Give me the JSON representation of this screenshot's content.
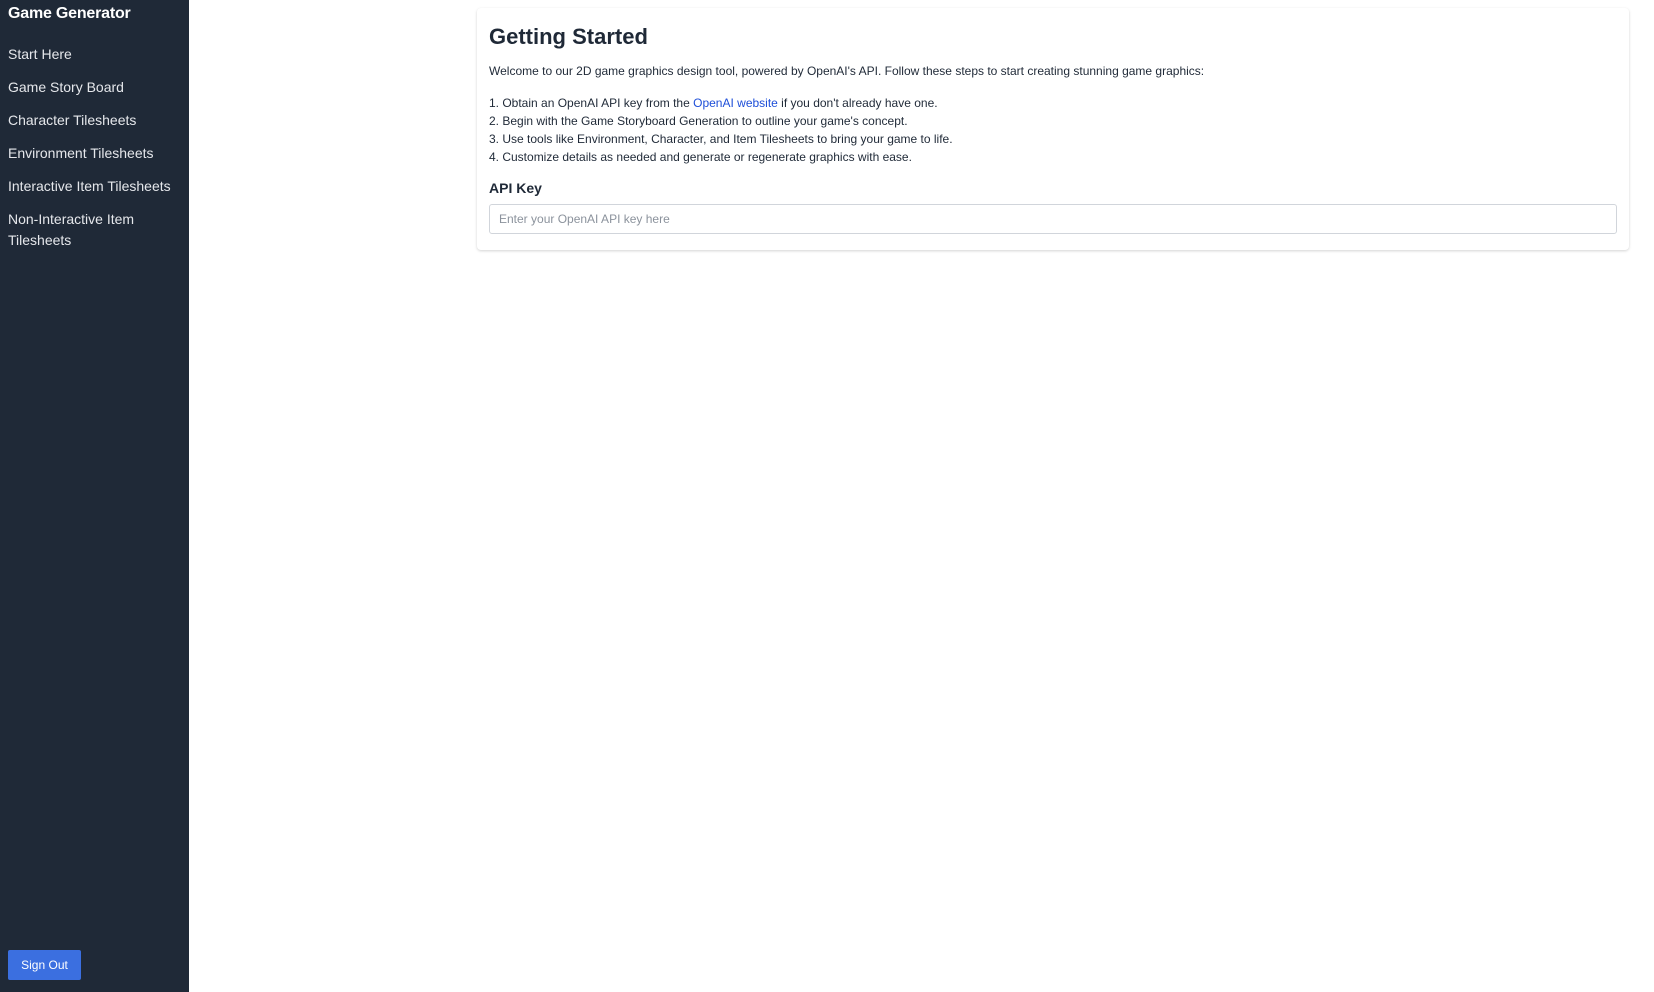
{
  "app": {
    "title": "Game Generator"
  },
  "sidebar": {
    "items": [
      {
        "label": "Start Here"
      },
      {
        "label": "Game Story Board"
      },
      {
        "label": "Character Tilesheets"
      },
      {
        "label": "Environment Tilesheets"
      },
      {
        "label": "Interactive Item Tilesheets"
      },
      {
        "label": "Non-Interactive Item Tilesheets"
      }
    ],
    "sign_out_label": "Sign Out"
  },
  "main": {
    "title": "Getting Started",
    "intro": "Welcome to our 2D game graphics design tool, powered by OpenAI's API. Follow these steps to start creating stunning game graphics:",
    "steps": {
      "step1_prefix": "1. Obtain an OpenAI API key from the ",
      "step1_link": "OpenAI website",
      "step1_suffix": " if you don't already have one.",
      "step2": "2. Begin with the Game Storyboard Generation to outline your game's concept.",
      "step3": "3. Use tools like Environment, Character, and Item Tilesheets to bring your game to life.",
      "step4": "4. Customize details as needed and generate or regenerate graphics with ease."
    },
    "api_key": {
      "label": "API Key",
      "value": "",
      "placeholder": "Enter your OpenAI API key here"
    }
  },
  "colors": {
    "sidebar_bg": "#1f2937",
    "accent": "#3b6fe0",
    "link": "#1d4ed8"
  }
}
